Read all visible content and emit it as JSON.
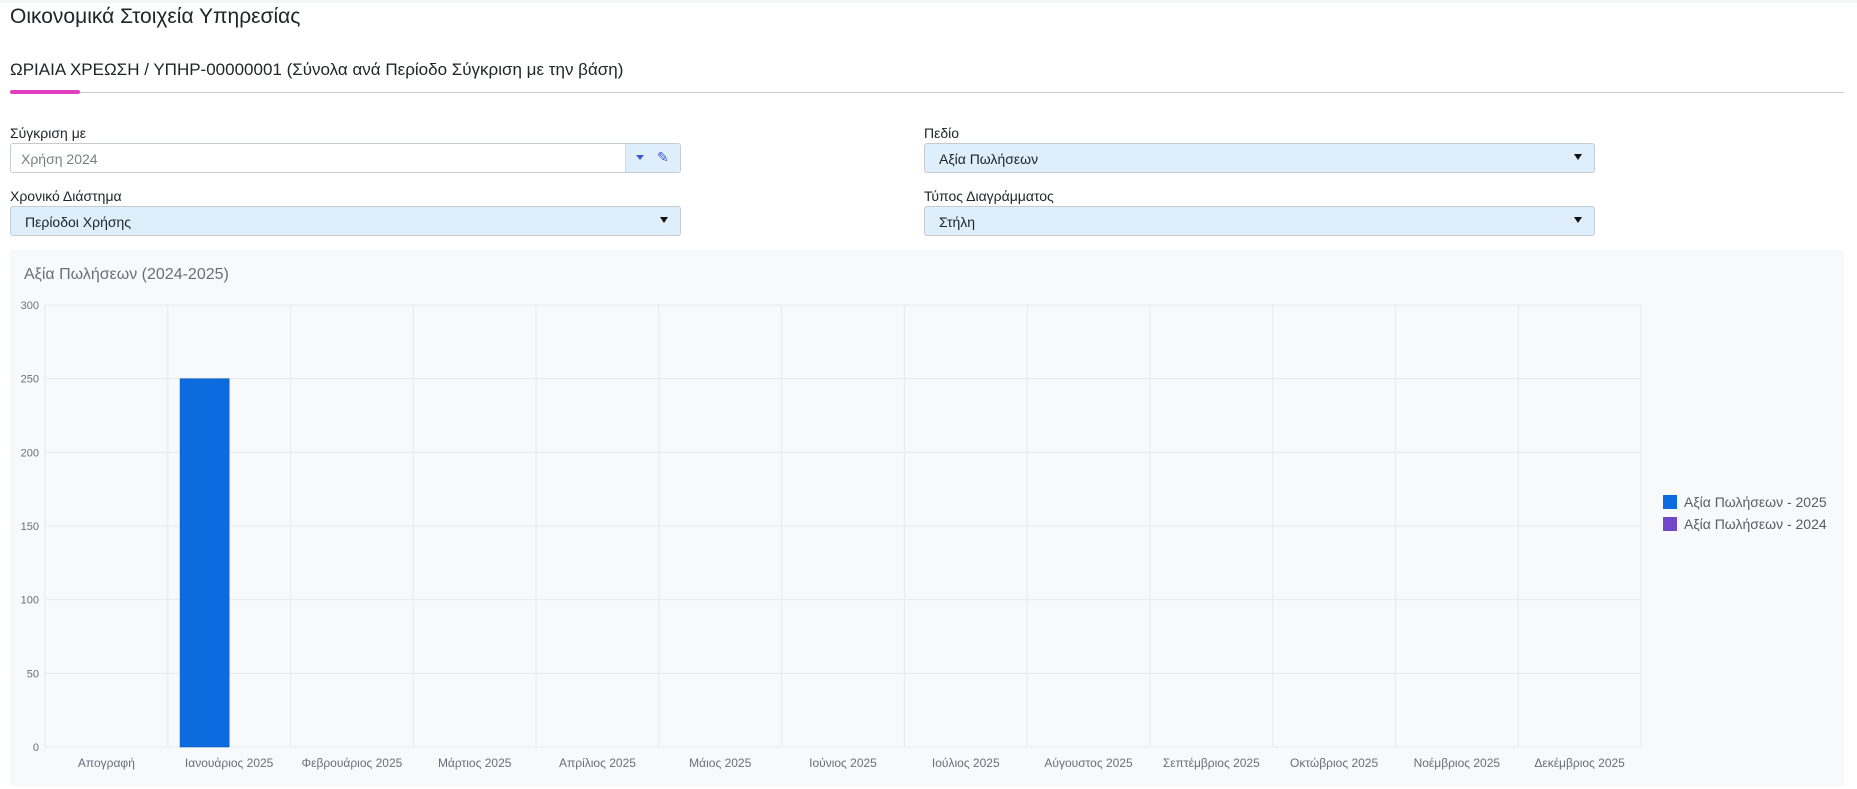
{
  "page": {
    "title": "Οικονομικά Στοιχεία Υπηρεσίας",
    "section_title": "ΩΡΙΑΙΑ ΧΡΕΩΣΗ / ΥΠΗΡ-00000001 (Σύνολα ανά Περίοδο Σύγκριση με την βάση)"
  },
  "filters": {
    "compare_with": {
      "label": "Σύγκριση με",
      "value": "Χρήση 2024"
    },
    "field": {
      "label": "Πεδίο",
      "value": "Αξία Πωλήσεων"
    },
    "time_range": {
      "label": "Χρονικό Διάστημα",
      "value": "Περίοδοι Χρήσης"
    },
    "chart_type": {
      "label": "Τύπος Διαγράμματος",
      "value": "Στήλη"
    }
  },
  "icons": {
    "dropdown": "triangle-down-icon",
    "edit": "pencil-icon"
  },
  "colors": {
    "accent": "#e040c0",
    "field_bg": "#deeefb",
    "series_2025": "#0d6be0",
    "series_2024": "#7048c8"
  },
  "chart_data": {
    "type": "bar",
    "title": "Αξία Πωλήσεων (2024-2025)",
    "categories": [
      "Απογραφή",
      "Ιανουάριος 2025",
      "Φεβρουάριος 2025",
      "Μάρτιος 2025",
      "Απρίλιος 2025",
      "Μάιος 2025",
      "Ιούνιος 2025",
      "Ιούλιος 2025",
      "Αύγουστος 2025",
      "Σεπτέμβριος 2025",
      "Οκτώβριος 2025",
      "Νοέμβριος 2025",
      "Δεκέμβριος 2025"
    ],
    "series": [
      {
        "name": "Αξία Πωλήσεων - 2025",
        "color": "#0d6be0",
        "values": [
          0,
          250,
          0,
          0,
          0,
          0,
          0,
          0,
          0,
          0,
          0,
          0,
          0
        ]
      },
      {
        "name": "Αξία Πωλήσεων - 2024",
        "color": "#7048c8",
        "values": [
          0,
          0,
          0,
          0,
          0,
          0,
          0,
          0,
          0,
          0,
          0,
          0,
          0
        ]
      }
    ],
    "yticks": [
      0,
      50,
      100,
      150,
      200,
      250,
      300
    ],
    "ylim": [
      0,
      300
    ],
    "grid": true,
    "legend_position": "right"
  }
}
